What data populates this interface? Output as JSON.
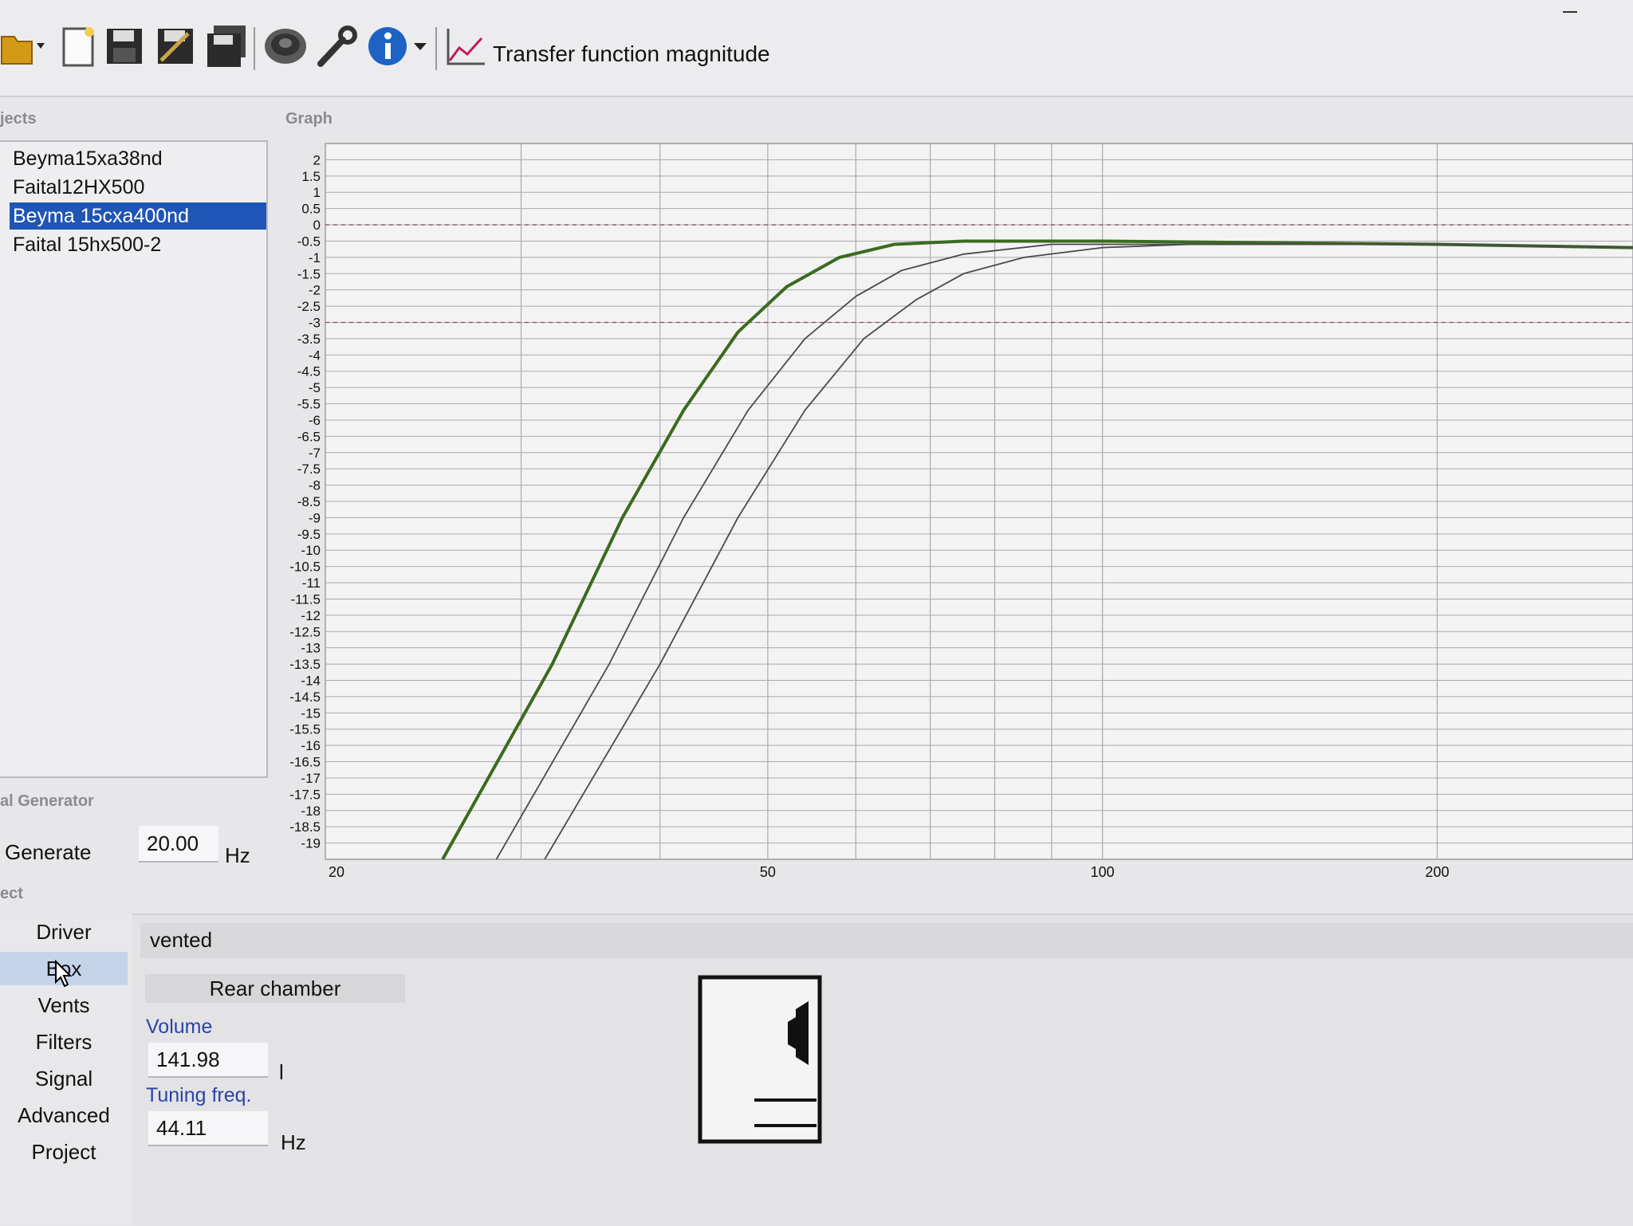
{
  "toolbar": {
    "title": "Transfer function magnitude",
    "buttons": [
      "open-icon",
      "new-icon",
      "save-icon",
      "save-edit-icon",
      "save-all-icon",
      "speaker-icon",
      "wrench-icon",
      "info-icon",
      "graph-icon"
    ]
  },
  "projects": {
    "label": "jects",
    "items": [
      "Beyma15xa38nd",
      "Faital12HX500",
      "Beyma 15cxa400nd",
      "Faital 15hx500-2"
    ],
    "selected_index": 2
  },
  "graph": {
    "label": "Graph"
  },
  "signal": {
    "label": "al Generator",
    "generate_label": "Generate",
    "freq_value": "20.00",
    "freq_unit": "Hz"
  },
  "nav": {
    "label": "ect",
    "items": [
      "Driver",
      "Box",
      "Vents",
      "Filters",
      "Signal",
      "Advanced",
      "Project"
    ],
    "active_index": 1
  },
  "box": {
    "type": "vented",
    "chamber_label": "Rear chamber",
    "volume_label": "Volume",
    "volume_value": "141.98",
    "volume_unit": "l",
    "tuning_label": "Tuning freq.",
    "tuning_value": "44.11",
    "tuning_unit": "Hz"
  },
  "chart_data": {
    "type": "line",
    "title": "",
    "xlabel": "",
    "ylabel": "",
    "x_scale": "log",
    "xlim": [
      20,
      300
    ],
    "ylim": [
      -19.5,
      2.5
    ],
    "x_ticks": [
      20,
      50,
      100,
      200
    ],
    "y_ticks": [
      2,
      1.5,
      1,
      0.5,
      0,
      -0.5,
      -1,
      -1.5,
      -2,
      -2.5,
      -3,
      -3.5,
      -4,
      -4.5,
      -5,
      -5.5,
      -6,
      -6.5,
      -7,
      -7.5,
      -8,
      -8.5,
      -9,
      -9.5,
      -10,
      -10.5,
      -11,
      -11.5,
      -12,
      -12.5,
      -13,
      -13.5,
      -14,
      -14.5,
      -15,
      -15.5,
      -16,
      -16.5,
      -17,
      -17.5,
      -18,
      -18.5,
      -19
    ],
    "reference_lines": [
      0,
      -3
    ],
    "grid": true,
    "series": [
      {
        "color": "#3a6b1f",
        "x": [
          25.5,
          32,
          37,
          42,
          47,
          52,
          58,
          65,
          75,
          100,
          200,
          300
        ],
        "y": [
          -19.5,
          -13.5,
          -9,
          -5.7,
          -3.3,
          -1.9,
          -1,
          -0.6,
          -0.5,
          -0.5,
          -0.6,
          -0.7
        ]
      },
      {
        "color": "#4a4a4a",
        "x": [
          28.5,
          36,
          42,
          48,
          54,
          60,
          66,
          75,
          90,
          100,
          200,
          300
        ],
        "y": [
          -19.5,
          -13.5,
          -9,
          -5.7,
          -3.5,
          -2.2,
          -1.4,
          -0.9,
          -0.6,
          -0.6,
          -0.6,
          -0.7
        ]
      },
      {
        "color": "#4a4a4a",
        "x": [
          31.5,
          40,
          47,
          54,
          61,
          68,
          75,
          85,
          100,
          120,
          200,
          300
        ],
        "y": [
          -19.5,
          -13.5,
          -9,
          -5.7,
          -3.5,
          -2.3,
          -1.5,
          -1,
          -0.7,
          -0.6,
          -0.6,
          -0.7
        ]
      }
    ]
  }
}
